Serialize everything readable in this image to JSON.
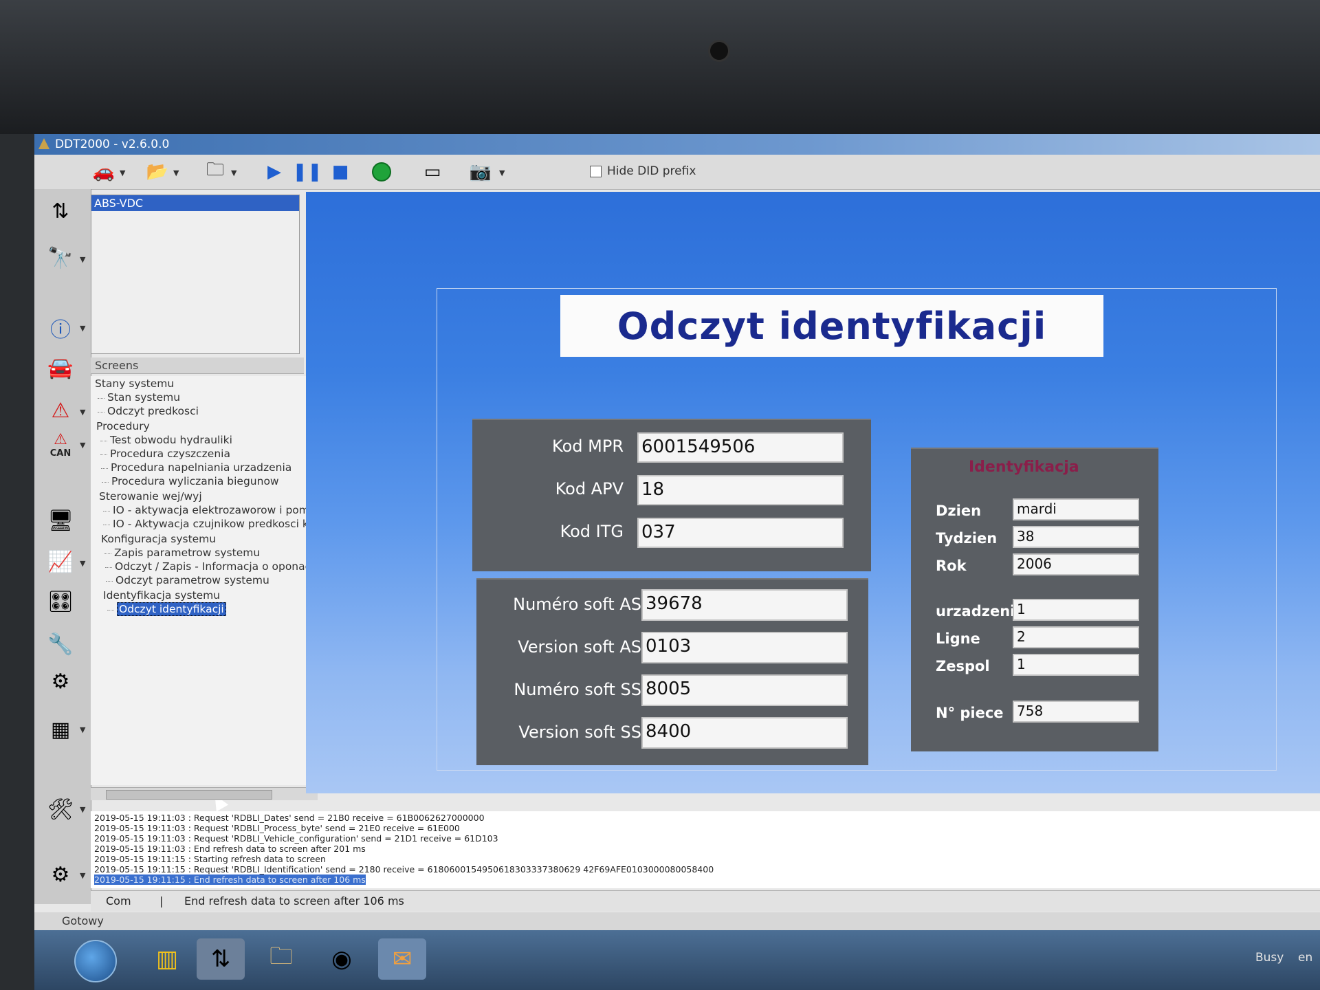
{
  "window": {
    "title": "DDT2000 - v2.6.0.0"
  },
  "toolbar": {
    "hide_did_prefix_label": "Hide DID prefix",
    "hide_did_prefix_checked": false,
    "icons": [
      "car-open-icon",
      "folder-user-icon",
      "folder-icon",
      "play-icon",
      "pause-icon",
      "stop-icon",
      "record-icon",
      "window-icon",
      "camera-icon"
    ]
  },
  "sidebar": {
    "icons": [
      "arrow-up-down-icon",
      "binoculars-icon",
      "info-icon",
      "car-icon",
      "warning-icon",
      "can-warning-icon",
      "monitor-icon",
      "graph-icon",
      "dashboard-icon",
      "tools-icon",
      "engine-icon",
      "chip-icon",
      "wrench-icon",
      "gear-icon"
    ],
    "can_label": "CAN"
  },
  "ecu_list": {
    "selected": "ABS-VDC"
  },
  "screens": {
    "header": "Screens",
    "tree": [
      {
        "label": "Stany systemu",
        "level": 0
      },
      {
        "label": "Stan systemu",
        "level": 1
      },
      {
        "label": "Odczyt predkosci",
        "level": 1
      },
      {
        "label": "Procedury",
        "level": 0
      },
      {
        "label": "Test obwodu hydrauliki",
        "level": 1
      },
      {
        "label": "Procedura czyszczenia",
        "level": 1
      },
      {
        "label": "Procedura napelniania urzadzenia",
        "level": 1
      },
      {
        "label": "Procedura wyliczania biegunow",
        "level": 1
      },
      {
        "label": "Sterowanie wej/wyj",
        "level": 0
      },
      {
        "label": "IO - aktywacja elektrozaworow i pompy",
        "level": 1
      },
      {
        "label": "IO - Aktywacja czujnikow predkosci kol",
        "level": 1
      },
      {
        "label": "Konfiguracja systemu",
        "level": 0
      },
      {
        "label": "Zapis parametrow systemu",
        "level": 1
      },
      {
        "label": "Odczyt / Zapis - Informacja o oponach",
        "level": 1
      },
      {
        "label": "Odczyt parametrow systemu",
        "level": 1
      },
      {
        "label": "Identyfikacja systemu",
        "level": 0
      },
      {
        "label": "Odczyt identyfikacji",
        "level": 1,
        "selected": true
      }
    ]
  },
  "screen": {
    "title": "Odczyt identyfikacji",
    "left_top": [
      {
        "label": "Kod MPR",
        "value": "6001549506"
      },
      {
        "label": "Kod APV",
        "value": "18"
      },
      {
        "label": "Kod ITG",
        "value": "037"
      }
    ],
    "left_bottom": [
      {
        "label": "Numéro soft AS",
        "value": "39678"
      },
      {
        "label": "Version soft AS",
        "value": "0103"
      },
      {
        "label": "Numéro soft SS",
        "value": "8005"
      },
      {
        "label": "Version soft SS",
        "value": "8400"
      }
    ],
    "identyfikacja": {
      "title": "Identyfikacja",
      "fields": [
        {
          "label": "Dzien",
          "value": "mardi"
        },
        {
          "label": "Tydzien",
          "value": "38"
        },
        {
          "label": "Rok",
          "value": "2006"
        },
        {
          "label": "urzadzenie",
          "value": "1"
        },
        {
          "label": "Ligne",
          "value": "2"
        },
        {
          "label": "Zespol",
          "value": "1"
        },
        {
          "label": "N° piece",
          "value": "758"
        }
      ]
    }
  },
  "log": {
    "lines": [
      "2019-05-15 19:11:03 : Request 'RDBLI_Dates' send = 21B0 receive = 61B0062627000000",
      "2019-05-15 19:11:03 : Request 'RDBLI_Process_byte' send = 21E0 receive = 61E000",
      "2019-05-15 19:11:03 : Request 'RDBLI_Vehicle_configuration' send = 21D1 receive = 61D103",
      "2019-05-15 19:11:03 : End refresh data to screen after 201 ms",
      "2019-05-15 19:11:15 : Starting refresh data to screen",
      "2019-05-15 19:11:15 : Request 'RDBLI_Identification' send = 2180 receive = 6180600154950618303337380629 42F69AFE0103000080058400",
      "2019-05-15 19:11:15 : End refresh data to screen after 106 ms"
    ]
  },
  "status": {
    "com_tab": "Com",
    "message": "End refresh data to screen after 106 ms",
    "ready": "Gotowy",
    "busy": "Busy",
    "lang": "en"
  }
}
